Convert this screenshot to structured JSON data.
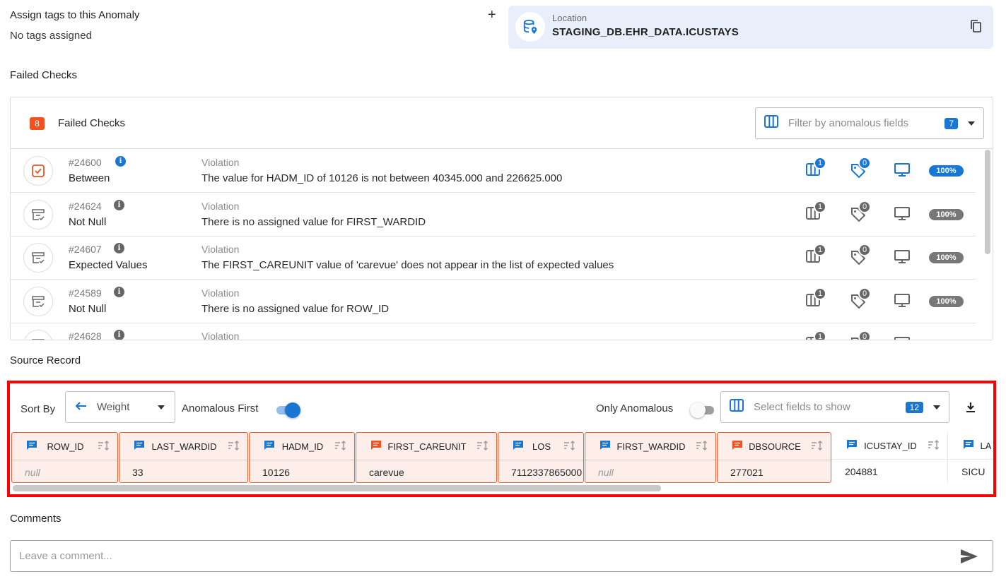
{
  "tags": {
    "title": "Assign tags to this Anomaly",
    "subtitle": "No tags assigned",
    "add_label": "+"
  },
  "location": {
    "label": "Location",
    "value": "STAGING_DB.EHR_DATA.ICUSTAYS"
  },
  "failed_checks": {
    "section_title": "Failed Checks",
    "count": "8",
    "header_title": "Failed Checks",
    "filter_placeholder": "Filter by anomalous fields",
    "filter_count": "7",
    "rows": [
      {
        "id": "#24600",
        "name": "Between",
        "violation_label": "Violation",
        "violation": "The value for HADM_ID of 10126 is not between 40345.000 and 226625.000",
        "fields_count": "1",
        "tags_count": "0",
        "percent": "100%",
        "active": true
      },
      {
        "id": "#24624",
        "name": "Not Null",
        "violation_label": "Violation",
        "violation": "There is no assigned value for FIRST_WARDID",
        "fields_count": "1",
        "tags_count": "0",
        "percent": "100%",
        "active": false
      },
      {
        "id": "#24607",
        "name": "Expected Values",
        "violation_label": "Violation",
        "violation": "The FIRST_CAREUNIT value of 'carevue' does not appear in the list of expected values",
        "fields_count": "1",
        "tags_count": "0",
        "percent": "100%",
        "active": false
      },
      {
        "id": "#24589",
        "name": "Not Null",
        "violation_label": "Violation",
        "violation": "There is no assigned value for ROW_ID",
        "fields_count": "1",
        "tags_count": "0",
        "percent": "100%",
        "active": false
      },
      {
        "id": "#24628",
        "name": "",
        "violation_label": "Violation",
        "violation": "",
        "fields_count": "1",
        "tags_count": "0",
        "percent": "",
        "active": false
      }
    ]
  },
  "source_record": {
    "section_title": "Source Record",
    "sort_by_label": "Sort By",
    "sort_value": "Weight",
    "anomalous_first_label": "Anomalous First",
    "anomalous_first_on": true,
    "only_anomalous_label": "Only Anomalous",
    "only_anomalous_on": false,
    "fields_placeholder": "Select fields to show",
    "fields_count": "12",
    "columns": [
      {
        "name": "ROW_ID",
        "value": "null",
        "anomalous": true,
        "is_null": true,
        "icon_color": "#1976d2"
      },
      {
        "name": "LAST_WARDID",
        "value": "33",
        "anomalous": true,
        "is_null": false,
        "icon_color": "#1976d2"
      },
      {
        "name": "HADM_ID",
        "value": "10126",
        "anomalous": true,
        "is_null": false,
        "icon_color": "#1976d2"
      },
      {
        "name": "FIRST_CAREUNIT",
        "value": "carevue",
        "anomalous": true,
        "is_null": false,
        "icon_color": "#f4511e"
      },
      {
        "name": "LOS",
        "value": "7112337865000",
        "anomalous": true,
        "is_null": false,
        "icon_color": "#1976d2"
      },
      {
        "name": "FIRST_WARDID",
        "value": "null",
        "anomalous": true,
        "is_null": true,
        "icon_color": "#1976d2"
      },
      {
        "name": "DBSOURCE",
        "value": "277021",
        "anomalous": true,
        "is_null": false,
        "icon_color": "#f4511e"
      },
      {
        "name": "ICUSTAY_ID",
        "value": "204881",
        "anomalous": false,
        "is_null": false,
        "icon_color": "#1976d2"
      },
      {
        "name": "LA",
        "value": "SICU",
        "anomalous": false,
        "is_null": false,
        "icon_color": "#1976d2"
      }
    ]
  },
  "comments": {
    "section_title": "Comments",
    "placeholder": "Leave a comment..."
  },
  "colors": {
    "accent": "#1976d2",
    "anomaly": "#f4511e",
    "highlight_border": "#ff0000"
  }
}
